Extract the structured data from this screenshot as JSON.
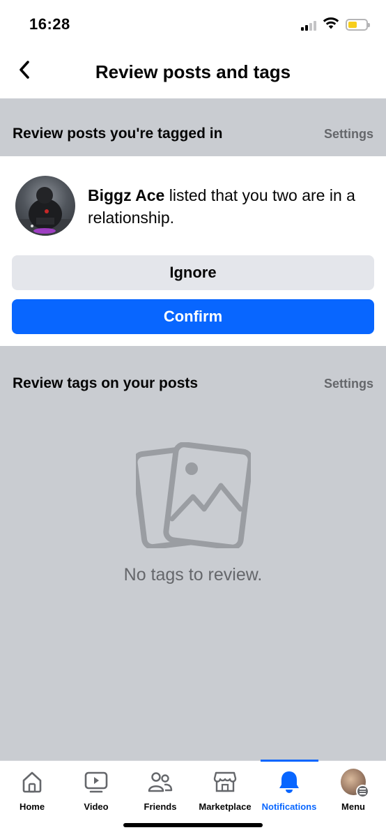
{
  "status_bar": {
    "time": "16:28",
    "icons": [
      "cellular-signal-icon",
      "wifi-icon",
      "battery-icon"
    ],
    "battery_color": "#f7ce1c"
  },
  "header": {
    "back_icon": "chevron-left-icon",
    "title": "Review posts and tags"
  },
  "tagged_section": {
    "title": "Review posts you're tagged in",
    "settings_label": "Settings",
    "request": {
      "name": "Biggz Ace",
      "message": " listed that you two are in a relationship.",
      "ignore_label": "Ignore",
      "confirm_label": "Confirm"
    }
  },
  "tags_section": {
    "title": "Review tags on your posts",
    "settings_label": "Settings",
    "empty_icon": "photos-icon",
    "empty_message": "No tags to review."
  },
  "bottom_nav": {
    "items": [
      {
        "label": "Home",
        "icon": "home-icon"
      },
      {
        "label": "Video",
        "icon": "video-icon"
      },
      {
        "label": "Friends",
        "icon": "friends-icon"
      },
      {
        "label": "Marketplace",
        "icon": "marketplace-icon"
      },
      {
        "label": "Notifications",
        "icon": "bell-icon",
        "active": true
      },
      {
        "label": "Menu",
        "icon": "profile-avatar"
      }
    ]
  },
  "colors": {
    "accent": "#0866ff",
    "section_bg": "#c9ccd1",
    "secondary_button": "#e4e6eb",
    "muted_text": "#65676b"
  }
}
